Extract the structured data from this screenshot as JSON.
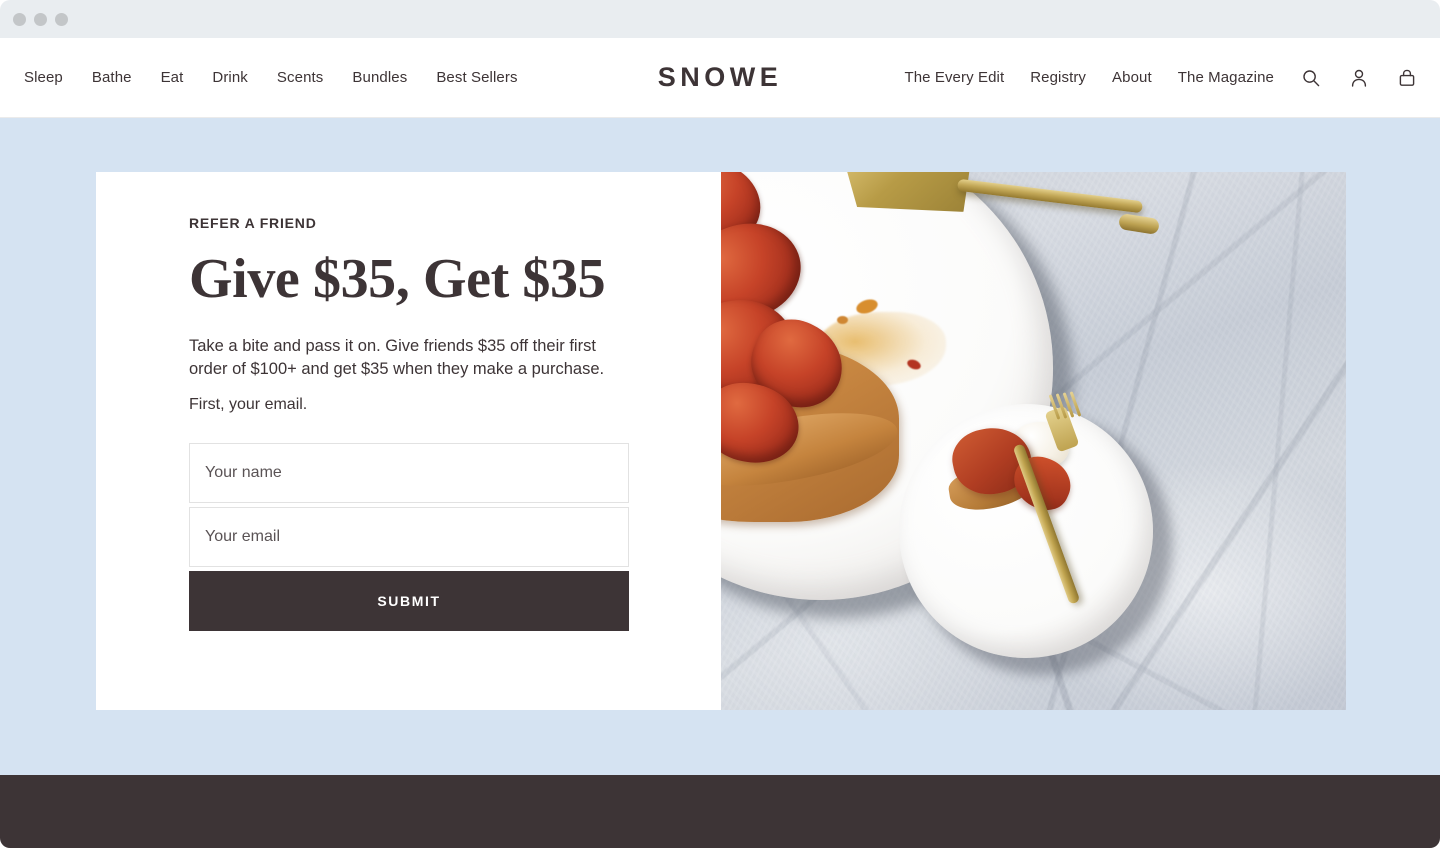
{
  "window": {
    "titlebar_dots": [
      "close",
      "minimize",
      "maximize"
    ],
    "chrome_color": "#e9edf0"
  },
  "header": {
    "brand": "SNOWE",
    "primary_nav": [
      {
        "label": "Sleep"
      },
      {
        "label": "Bathe"
      },
      {
        "label": "Eat"
      },
      {
        "label": "Drink"
      },
      {
        "label": "Scents"
      },
      {
        "label": "Bundles"
      },
      {
        "label": "Best Sellers"
      }
    ],
    "secondary_nav": [
      {
        "label": "The Every Edit"
      },
      {
        "label": "Registry"
      },
      {
        "label": "About"
      },
      {
        "label": "The Magazine"
      }
    ],
    "icons": [
      {
        "name": "search-icon"
      },
      {
        "name": "account-icon"
      },
      {
        "name": "shopping-bag-icon"
      }
    ]
  },
  "promo": {
    "eyebrow": "REFER A FRIEND",
    "heading": "Give $35, Get $35",
    "body": "Take a bite and pass it on. Give friends $35 off their first order of $100+ and get $35 when they make a purchase.",
    "subcopy": "First, your email.",
    "form": {
      "name_value": "",
      "name_placeholder": "Your name",
      "email_value": "",
      "email_placeholder": "Your email",
      "submit_label": "SUBMIT"
    },
    "photo_alt": "Tarte tatin on a white plate with a gold cake server, and a slice with cream and a gold fork on a second plate, set on a grey marble surface"
  },
  "colors": {
    "page_background": "#d5e3f2",
    "card_background": "#ffffff",
    "ink": "#3d3436",
    "footer": "#3d3436",
    "field_border": "#e2e2e2"
  }
}
